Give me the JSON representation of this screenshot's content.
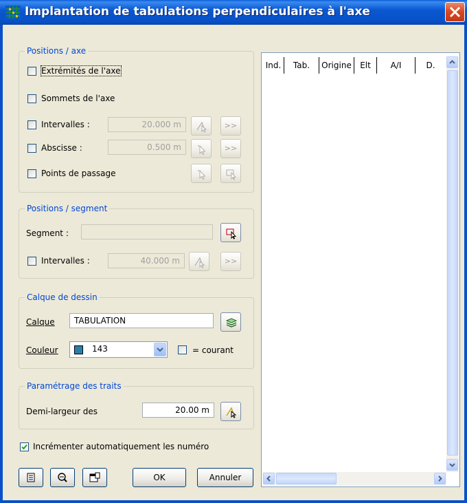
{
  "window": {
    "title": "Implantation de tabulations perpendiculaires à l'axe",
    "app_icon": "grid-icon",
    "close_icon": "close-icon"
  },
  "positions_axe": {
    "legend": "Positions / axe",
    "extremites_label": "Extrémités de l'axe",
    "extremites_checked": false,
    "sommets_label": "Sommets de l'axe",
    "sommets_checked": false,
    "intervalles_label": "Intervalles :",
    "intervalles_checked": false,
    "intervalles_value": "20.000 m",
    "abscisse_label": "Abscisse :",
    "abscisse_checked": false,
    "abscisse_value": "0.500 m",
    "points_label": "Points de passage",
    "points_checked": false,
    "more_label": ">>"
  },
  "positions_segment": {
    "legend": "Positions / segment",
    "segment_label": "Segment :",
    "segment_value": "",
    "intervalles_label": "Intervalles :",
    "intervalles_checked": false,
    "intervalles_value": "40.000 m",
    "more_label": ">>"
  },
  "calque": {
    "legend": "Calque de dessin",
    "calque_label": "Calque",
    "calque_value": "TABULATION",
    "couleur_label": "Couleur",
    "couleur_value": "143",
    "couleur_swatch": "#2a7fa8",
    "courant_label": "= courant",
    "courant_checked": false
  },
  "traits": {
    "legend": "Paramétrage des traits",
    "demi_largeur_label": "Demi-largeur des",
    "demi_largeur_value": "20.00 m"
  },
  "incrementer": {
    "label": "Incrémenter automatiquement les numéro",
    "checked": true
  },
  "buttons": {
    "ok": "OK",
    "annuler": "Annuler"
  },
  "table": {
    "columns": [
      "Ind.",
      "Tab.",
      "Origine",
      "Elt",
      "A/I",
      "D."
    ],
    "rows": []
  },
  "colors": {
    "title_bar": "#0a58d0",
    "group_legend": "#0046d5",
    "dialog_bg": "#ece9d8"
  }
}
